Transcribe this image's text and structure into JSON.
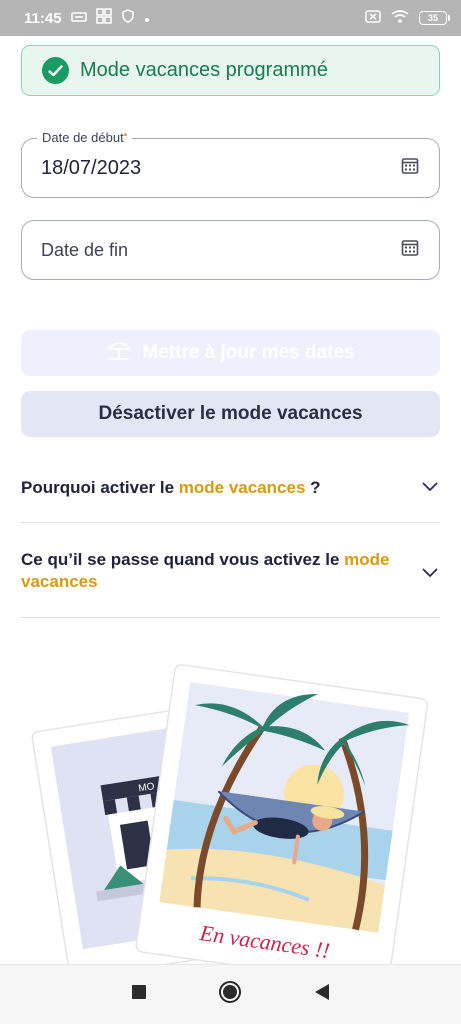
{
  "status_bar": {
    "time": "11:45",
    "battery": "35",
    "icons": [
      "sim-icon",
      "apps-icon",
      "shield-icon",
      "dot-icon",
      "no-sim-icon",
      "wifi-icon",
      "battery-icon"
    ]
  },
  "banner": {
    "text": "Mode vacances programmé",
    "icon": "check-circle-icon"
  },
  "start_date": {
    "label": "Date de début",
    "required_mark": "•",
    "value": "18/07/2023",
    "icon": "calendar-icon"
  },
  "end_date": {
    "placeholder": "Date de fin",
    "icon": "calendar-icon"
  },
  "buttons": {
    "update_label": "Mettre à jour mes dates",
    "update_icon": "beach-umbrella-icon",
    "deactivate_label": "Désactiver le mode vacances"
  },
  "faq": [
    {
      "prefix": "Pourquoi activer le ",
      "highlight": "mode vacances",
      "suffix": " ?"
    },
    {
      "prefix": "Ce qu’il se passe quand vous activez le ",
      "highlight": "mode vacances",
      "suffix": ""
    }
  ],
  "illustration": {
    "caption": "En vacances !!",
    "shop_sign": "MO"
  },
  "colors": {
    "success": "#1a9b64",
    "highlight": "#d79a10",
    "button_secondary_bg": "#e3e6f4"
  }
}
